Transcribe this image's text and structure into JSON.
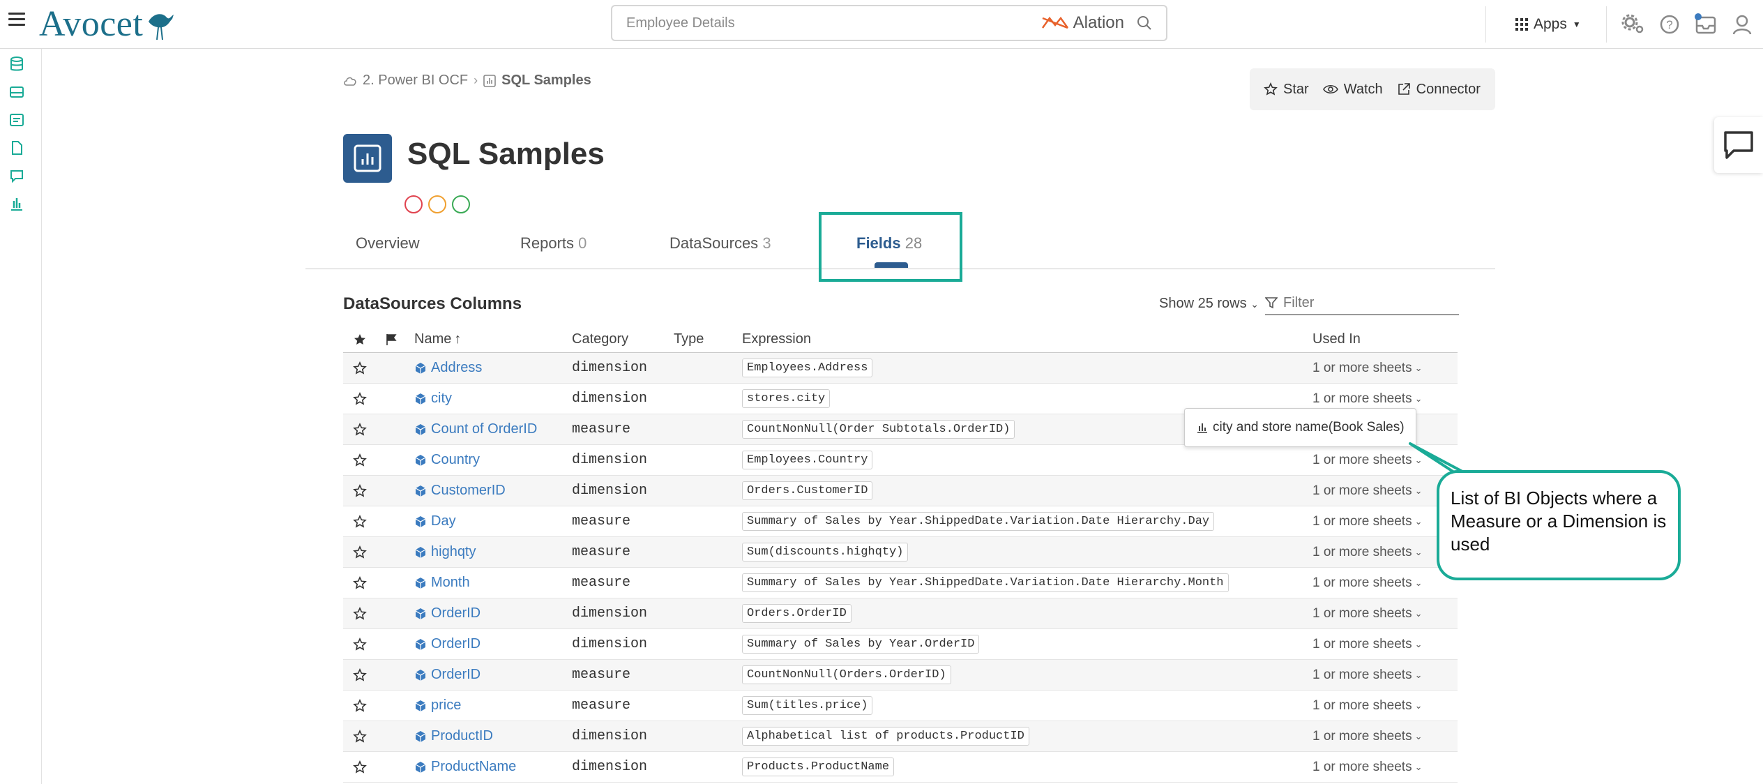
{
  "app": {
    "logo_text": "Avocet",
    "search_placeholder": "Employee Details",
    "search_brand": "Alation",
    "apps_label": "Apps"
  },
  "breadcrumb": {
    "parent": "2. Power BI OCF",
    "current": "SQL Samples"
  },
  "actions": {
    "star": "Star",
    "watch": "Watch",
    "connector": "Connector"
  },
  "page": {
    "title": "SQL Samples"
  },
  "tabs": [
    {
      "label": "Overview",
      "count": ""
    },
    {
      "label": "Reports",
      "count": "0"
    },
    {
      "label": "DataSources",
      "count": "3"
    },
    {
      "label": "Fields",
      "count": "28"
    }
  ],
  "section": {
    "title": "DataSources Columns",
    "show_rows": "Show 25 rows",
    "filter_placeholder": "Filter"
  },
  "table": {
    "headers": {
      "name": "Name",
      "category": "Category",
      "type": "Type",
      "expression": "Expression",
      "used_in": "Used In"
    },
    "rows": [
      {
        "name": "Address",
        "category": "dimension",
        "expression": "Employees.Address",
        "used_in": "1 or more sheets"
      },
      {
        "name": "city",
        "category": "dimension",
        "expression": "stores.city",
        "used_in": "1 or more sheets"
      },
      {
        "name": "Count of OrderID",
        "category": "measure",
        "expression": "CountNonNull(Order Subtotals.OrderID)",
        "used_in": ""
      },
      {
        "name": "Country",
        "category": "dimension",
        "expression": "Employees.Country",
        "used_in": "1 or more sheets"
      },
      {
        "name": "CustomerID",
        "category": "dimension",
        "expression": "Orders.CustomerID",
        "used_in": "1 or more sheets"
      },
      {
        "name": "Day",
        "category": "measure",
        "expression": "Summary of Sales by Year.ShippedDate.Variation.Date Hierarchy.Day",
        "used_in": "1 or more sheets"
      },
      {
        "name": "highqty",
        "category": "measure",
        "expression": "Sum(discounts.highqty)",
        "used_in": "1 or more sheets"
      },
      {
        "name": "Month",
        "category": "measure",
        "expression": "Summary of Sales by Year.ShippedDate.Variation.Date Hierarchy.Month",
        "used_in": "1 or more sheets"
      },
      {
        "name": "OrderID",
        "category": "dimension",
        "expression": "Orders.OrderID",
        "used_in": "1 or more sheets"
      },
      {
        "name": "OrderID",
        "category": "dimension",
        "expression": "Summary of Sales by Year.OrderID",
        "used_in": "1 or more sheets"
      },
      {
        "name": "OrderID",
        "category": "measure",
        "expression": "CountNonNull(Orders.OrderID)",
        "used_in": "1 or more sheets"
      },
      {
        "name": "price",
        "category": "measure",
        "expression": "Sum(titles.price)",
        "used_in": "1 or more sheets"
      },
      {
        "name": "ProductID",
        "category": "dimension",
        "expression": "Alphabetical list of products.ProductID",
        "used_in": "1 or more sheets"
      },
      {
        "name": "ProductName",
        "category": "dimension",
        "expression": "Products.ProductName",
        "used_in": "1 or more sheets"
      }
    ]
  },
  "popover": {
    "text": "city and store name(Book Sales)"
  },
  "callout": {
    "text": "List of BI Objects where a Measure or a Dimension is used"
  },
  "colors": {
    "accent": "#2d5c8f",
    "link": "#3b7bbf",
    "highlight": "#1aab97"
  }
}
